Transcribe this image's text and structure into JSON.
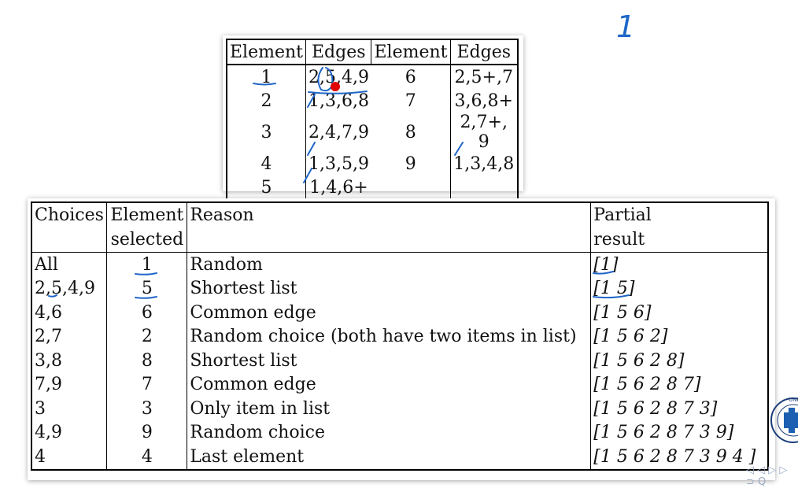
{
  "slide_number_annotation": "1",
  "edges_table": {
    "headers": [
      "Element",
      "Edges",
      "Element",
      "Edges"
    ],
    "rows": [
      [
        "1",
        "2,5,4,9",
        "6",
        "2,5+,7"
      ],
      [
        "2",
        "1,3,6,8",
        "7",
        "3,6,8+"
      ],
      [
        "3",
        "2,4,7,9",
        "8",
        "2,7+, 9"
      ],
      [
        "4",
        "1,3,5,9",
        "9",
        "1,3,4,8"
      ],
      [
        "5",
        "1,4,6+",
        "",
        ""
      ]
    ]
  },
  "choices_table": {
    "headers": {
      "choices": "Choices",
      "element_line1": "Element",
      "element_line2": "selected",
      "reason": "Reason",
      "partial_line1": "Partial",
      "partial_line2": "result"
    },
    "rows": [
      {
        "choices": "All",
        "element": "1",
        "reason": "Random",
        "partial": "[1]"
      },
      {
        "choices": "2,5,4,9",
        "element": "5",
        "reason": "Shortest list",
        "partial": "[1 5]"
      },
      {
        "choices": "4,6",
        "element": "6",
        "reason": "Common edge",
        "partial": "[1 5 6]"
      },
      {
        "choices": "2,7",
        "element": "2",
        "reason": "Random choice (both have two items in list)",
        "partial": "[1 5 6 2]"
      },
      {
        "choices": "3,8",
        "element": "8",
        "reason": "Shortest list",
        "partial": "[1 5 6 2 8]"
      },
      {
        "choices": "7,9",
        "element": "7",
        "reason": "Common edge",
        "partial": "[1 5 6 2 8 7]"
      },
      {
        "choices": "3",
        "element": "3",
        "reason": "Only item in list",
        "partial": "[1 5 6 2 8 7 3]"
      },
      {
        "choices": "4,9",
        "element": "9",
        "reason": "Random choice",
        "partial": "[1 5 6 2 8 7 3 9]"
      },
      {
        "choices": "4",
        "element": "4",
        "reason": "Last element",
        "partial": "[1 5 6 2 8 7 3 9 4 ]"
      }
    ]
  },
  "annotation_color": "#1f66c8",
  "pointer_color": "#e00000",
  "logo": {
    "text": "UNIVERSITET",
    "icon": "university-seal-icon"
  },
  "nav_icons": [
    "nav-arrows-icon",
    "search-icon"
  ]
}
